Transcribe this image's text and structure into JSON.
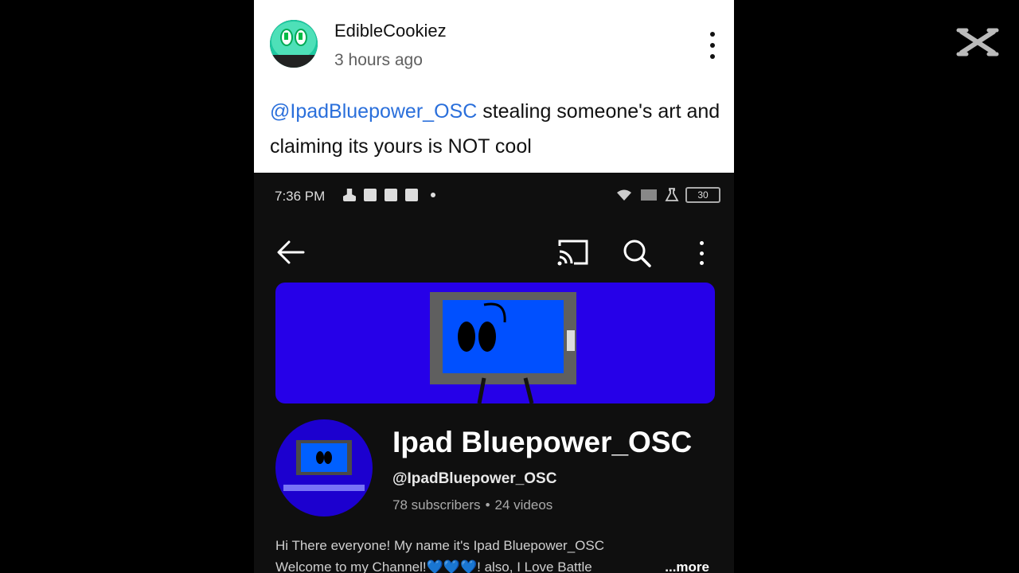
{
  "comment": {
    "username": "EdibleCookiez",
    "time": "3 hours ago",
    "mention": "@IpadBluepower_OSC",
    "text": " stealing someone's art and claiming its yours is NOT cool"
  },
  "phone": {
    "status": {
      "time": "7:36 PM",
      "battery": "30"
    },
    "channel": {
      "name": "Ipad Bluepower_OSC",
      "handle": "@IpadBluepower_OSC",
      "subscribers": "78 subscribers",
      "separator": "•",
      "videos": "24 videos",
      "desc_line1": "Hi There everyone! My name it's Ipad Bluepower_OSC",
      "desc_line2_a": "Welcome to my Channel!",
      "hearts": "💙💙💙",
      "desc_line2_b": "! also, I Love Battle",
      "more": "...more"
    }
  },
  "icons": {
    "back": "arrow-left-icon",
    "cast": "cast-icon",
    "search": "search-icon",
    "more": "more-vertical-icon",
    "watermark": "capcut-logo-icon"
  },
  "colors": {
    "banner": "#2600e8",
    "mention": "#2a6fdb",
    "background": "#0f0f0f"
  }
}
